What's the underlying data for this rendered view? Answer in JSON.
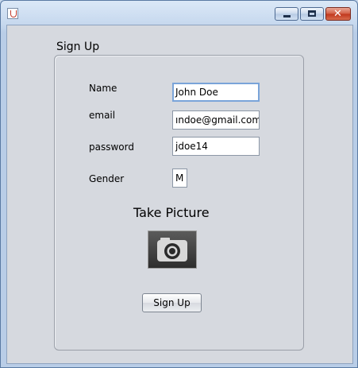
{
  "window": {
    "title": ""
  },
  "form": {
    "title": "Sign Up",
    "fields": {
      "name": {
        "label": "Name",
        "value": "John Doe"
      },
      "email": {
        "label": "email",
        "value": "ındoe@gmail.com"
      },
      "password": {
        "label": "password",
        "value": "jdoe14"
      },
      "gender": {
        "label": "Gender",
        "value": "M"
      }
    },
    "take_picture_label": "Take Picture",
    "signup_button_label": "Sign Up"
  },
  "icons": {
    "app": "java-app-icon",
    "minimize": "minimize-icon",
    "maximize": "maximize-icon",
    "close": "close-icon",
    "camera": "camera-icon"
  }
}
